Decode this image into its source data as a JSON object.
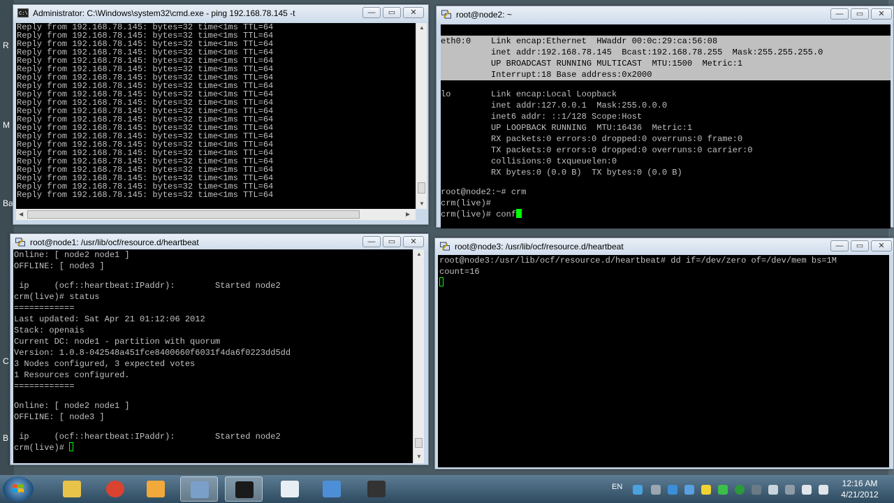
{
  "desktop": {
    "edge_letters": [
      "R",
      "M",
      "Ba",
      "C",
      "B"
    ]
  },
  "cmd_window": {
    "title": "Administrator: C:\\Windows\\system32\\cmd.exe - ping  192.168.78.145 -t",
    "lines": [
      "Reply from 192.168.78.145: bytes=32 time<1ms TTL=64",
      "Reply from 192.168.78.145: bytes=32 time<1ms TTL=64",
      "Reply from 192.168.78.145: bytes=32 time<1ms TTL=64",
      "Reply from 192.168.78.145: bytes=32 time<1ms TTL=64",
      "Reply from 192.168.78.145: bytes=32 time<1ms TTL=64",
      "Reply from 192.168.78.145: bytes=32 time<1ms TTL=64",
      "Reply from 192.168.78.145: bytes=32 time<1ms TTL=64",
      "Reply from 192.168.78.145: bytes=32 time<1ms TTL=64",
      "Reply from 192.168.78.145: bytes=32 time<1ms TTL=64",
      "Reply from 192.168.78.145: bytes=32 time<1ms TTL=64",
      "Reply from 192.168.78.145: bytes=32 time<1ms TTL=64",
      "Reply from 192.168.78.145: bytes=32 time<1ms TTL=64",
      "Reply from 192.168.78.145: bytes=32 time<1ms TTL=64",
      "Reply from 192.168.78.145: bytes=32 time<1ms TTL=64",
      "Reply from 192.168.78.145: bytes=32 time<1ms TTL=64",
      "Reply from 192.168.78.145: bytes=32 time<1ms TTL=64",
      "Reply from 192.168.78.145: bytes=32 time<1ms TTL=64",
      "Reply from 192.168.78.145: bytes=32 time<1ms TTL=64",
      "Reply from 192.168.78.145: bytes=32 time<1ms TTL=64",
      "Reply from 192.168.78.145: bytes=32 time<1ms TTL=64",
      "Reply from 192.168.78.145: bytes=32 time<1ms TTL=64"
    ]
  },
  "node2_window": {
    "title": "root@node2: ~",
    "selected_lines": [
      "eth0:0    Link encap:Ethernet  HWaddr 00:0c:29:ca:56:08",
      "          inet addr:192.168.78.145  Bcast:192.168.78.255  Mask:255.255.255.0",
      "          UP BROADCAST RUNNING MULTICAST  MTU:1500  Metric:1",
      "          Interrupt:18 Base address:0x2000 "
    ],
    "lines": [
      "",
      "lo        Link encap:Local Loopback",
      "          inet addr:127.0.0.1  Mask:255.0.0.0",
      "          inet6 addr: ::1/128 Scope:Host",
      "          UP LOOPBACK RUNNING  MTU:16436  Metric:1",
      "          RX packets:0 errors:0 dropped:0 overruns:0 frame:0",
      "          TX packets:0 errors:0 dropped:0 overruns:0 carrier:0",
      "          collisions:0 txqueuelen:0",
      "          RX bytes:0 (0.0 B)  TX bytes:0 (0.0 B)",
      "",
      "root@node2:~# crm",
      "crm(live)#"
    ],
    "prompt": "crm(live)# ",
    "typed": "conf"
  },
  "node1_window": {
    "title": "root@node1: /usr/lib/ocf/resource.d/heartbeat",
    "lines": [
      "Online: [ node2 node1 ]",
      "OFFLINE: [ node3 ]",
      "",
      " ip     (ocf::heartbeat:IPaddr):        Started node2",
      "crm(live)# status",
      "============",
      "Last updated: Sat Apr 21 01:12:06 2012",
      "Stack: openais",
      "Current DC: node1 - partition with quorum",
      "Version: 1.0.8-042548a451fce8400660f6031f4da6f0223dd5dd",
      "3 Nodes configured, 3 expected votes",
      "1 Resources configured.",
      "============",
      "",
      "Online: [ node2 node1 ]",
      "OFFLINE: [ node3 ]",
      "",
      " ip     (ocf::heartbeat:IPaddr):        Started node2"
    ],
    "prompt": "crm(live)# "
  },
  "node3_window": {
    "title": "root@node3: /usr/lib/ocf/resource.d/heartbeat",
    "lines": [
      "root@node3:/usr/lib/ocf/resource.d/heartbeat# dd if=/dev/zero of=/dev/mem bs=1M",
      "count=16"
    ]
  },
  "window_controls": {
    "minimize": "—",
    "maximize": "▭",
    "close": "✕"
  },
  "taskbar": {
    "buttons": [
      {
        "name": "snipping-tool",
        "color": "#e8c34a"
      },
      {
        "name": "chrome",
        "color": "#d9432f"
      },
      {
        "name": "folder",
        "color": "#f0a93a"
      },
      {
        "name": "putty",
        "color": "#7a9fc9"
      },
      {
        "name": "cmd",
        "color": "#1a1a1a"
      },
      {
        "name": "document",
        "color": "#e9eef4"
      },
      {
        "name": "network",
        "color": "#4d8fd6"
      },
      {
        "name": "usb-device",
        "color": "#333333"
      }
    ],
    "language": "EN",
    "clock_time": "12:16 AM",
    "clock_date": "4/21/2012"
  }
}
